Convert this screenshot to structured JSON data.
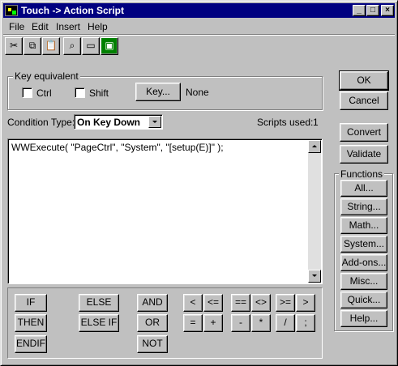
{
  "window": {
    "title": "Touch -> Action Script",
    "controls": {
      "minimize": "_",
      "maximize": "□",
      "close": "×"
    }
  },
  "menu": [
    {
      "label": "File"
    },
    {
      "label": "Edit"
    },
    {
      "label": "Insert"
    },
    {
      "label": "Help"
    }
  ],
  "toolbar": [
    {
      "icon": "cut-icon",
      "glyph": "✂"
    },
    {
      "icon": "copy-icon",
      "glyph": "⧉"
    },
    {
      "icon": "paste-icon",
      "glyph": "📋"
    },
    {
      "icon": "find-icon",
      "glyph": "⌕"
    },
    {
      "icon": "window-icon",
      "glyph": "▭"
    },
    {
      "icon": "script-icon",
      "glyph": "▣"
    }
  ],
  "key_equivalent": {
    "group_label": "Key equivalent",
    "ctrl_label": "Ctrl",
    "shift_label": "Shift",
    "key_button": "Key...",
    "key_value": "None"
  },
  "condition": {
    "label": "Condition Type:",
    "selected": "On Key Down",
    "scripts_used_label": "Scripts used:",
    "scripts_used_value": "1"
  },
  "script": {
    "text": "WWExecute( \"PageCtrl\", \"System\", \"[setup(E)]\" );"
  },
  "dialog_buttons": {
    "ok": "OK",
    "cancel": "Cancel",
    "convert": "Convert",
    "validate": "Validate"
  },
  "functions": {
    "group_label": "Functions",
    "buttons": [
      "All...",
      "String...",
      "Math...",
      "System...",
      "Add-ons...",
      "Misc...",
      "Quick...",
      "Help..."
    ]
  },
  "operators": {
    "if": "IF",
    "then": "THEN",
    "endif": "ENDIF",
    "else": "ELSE",
    "elseif": "ELSE IF",
    "and": "AND",
    "or": "OR",
    "not": "NOT",
    "lt": "<",
    "le": "<=",
    "plus": "=",
    "add": "+",
    "eq": "==",
    "ne": "<>",
    "minus": "-",
    "mul": "*",
    "ge": ">=",
    "gt": ">",
    "div": "/",
    "semi": ";"
  },
  "colors": {
    "title_bar": "#000080",
    "face": "#c0c0c0"
  }
}
